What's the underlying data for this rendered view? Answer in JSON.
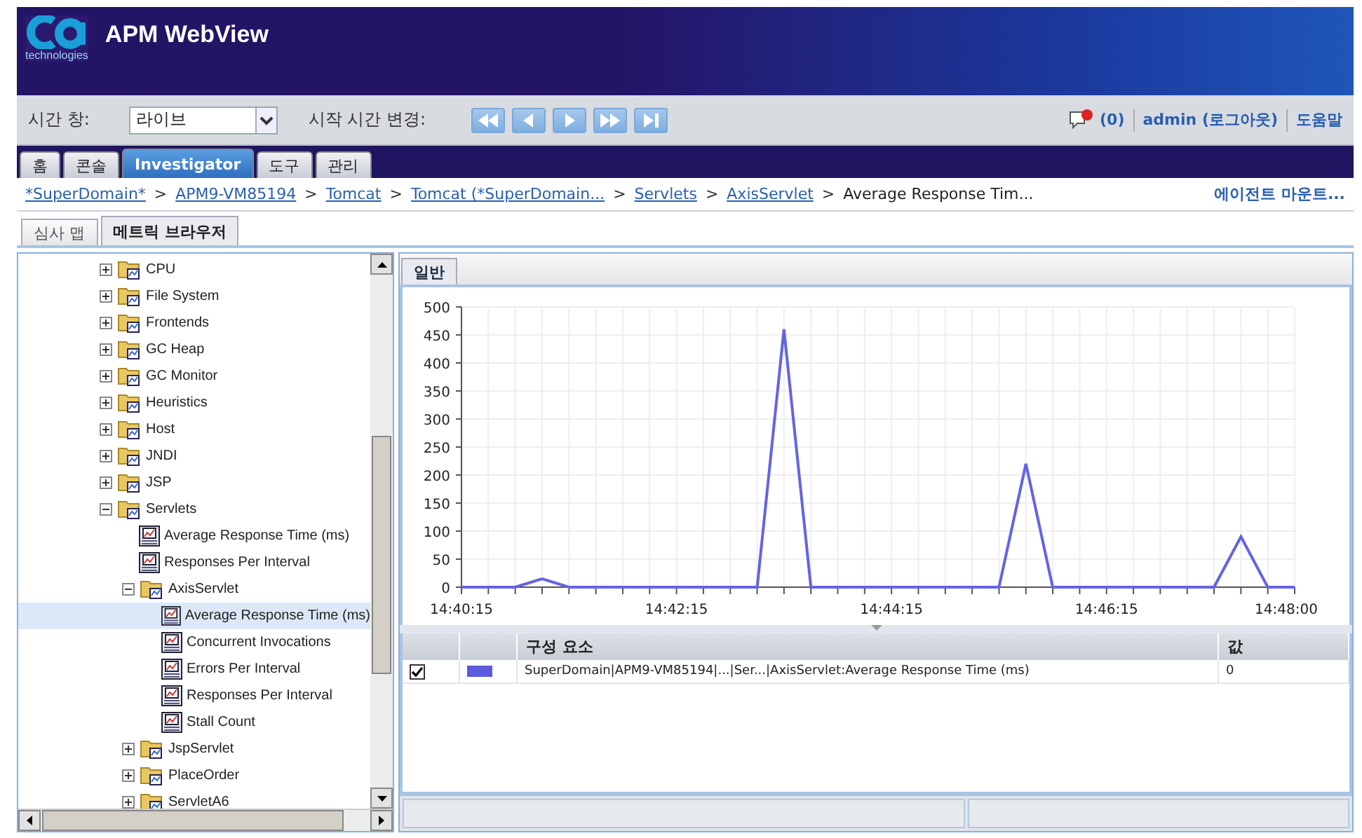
{
  "header": {
    "logo_text": "technologies",
    "title": "APM WebView"
  },
  "toolbar": {
    "time_window_label": "시간 창:",
    "time_window_value": "라이브",
    "start_time_label": "시작 시간 변경:",
    "alerts": "(0)",
    "user": "admin (로그아웃)",
    "help": "도움말"
  },
  "tabs": [
    {
      "label": "홈",
      "selected": false
    },
    {
      "label": "콘솔",
      "selected": false
    },
    {
      "label": "Investigator",
      "selected": true
    },
    {
      "label": "도구",
      "selected": false
    },
    {
      "label": "관리",
      "selected": false
    }
  ],
  "breadcrumb": {
    "items": [
      {
        "label": "*SuperDomain*",
        "kind": "link"
      },
      {
        "label": ">",
        "kind": "separator"
      },
      {
        "label": "APM9-VM85194",
        "kind": "link"
      },
      {
        "label": ">",
        "kind": "separator"
      },
      {
        "label": "Tomcat",
        "kind": "link"
      },
      {
        "label": ">",
        "kind": "separator"
      },
      {
        "label": "Tomcat (*SuperDomain...",
        "kind": "link"
      },
      {
        "label": ">",
        "kind": "separator"
      },
      {
        "label": "Servlets",
        "kind": "link"
      },
      {
        "label": ">",
        "kind": "separator"
      },
      {
        "label": "AxisServlet",
        "kind": "link"
      },
      {
        "label": ">",
        "kind": "separator"
      },
      {
        "label": "Average Response Tim...",
        "kind": "current"
      }
    ],
    "agent_mount": "에이전트 마운트..."
  },
  "sub_tabs": [
    {
      "label": "심사 맵",
      "selected": false
    },
    {
      "label": "메트릭 브라우저",
      "selected": true
    }
  ],
  "tree": [
    {
      "label": "CPU",
      "kind": "folder",
      "expanded": false,
      "selected": false
    },
    {
      "label": "File System",
      "kind": "folder",
      "expanded": false,
      "selected": false
    },
    {
      "label": "Frontends",
      "kind": "folder",
      "expanded": false,
      "selected": false
    },
    {
      "label": "GC Heap",
      "kind": "folder",
      "expanded": false,
      "selected": false
    },
    {
      "label": "GC Monitor",
      "kind": "folder",
      "expanded": false,
      "selected": false
    },
    {
      "label": "Heuristics",
      "kind": "folder",
      "expanded": false,
      "selected": false
    },
    {
      "label": "Host",
      "kind": "folder",
      "expanded": false,
      "selected": false
    },
    {
      "label": "JNDI",
      "kind": "folder",
      "expanded": false,
      "selected": false
    },
    {
      "label": "JSP",
      "kind": "folder",
      "expanded": false,
      "selected": false
    },
    {
      "label": "Servlets",
      "kind": "folder",
      "expanded": true,
      "selected": false,
      "children": [
        {
          "label": "Average Response Time (ms)",
          "kind": "metric",
          "selected": false
        },
        {
          "label": "Responses Per Interval",
          "kind": "metric",
          "selected": false
        },
        {
          "label": "AxisServlet",
          "kind": "folder",
          "expanded": true,
          "selected": false,
          "children": [
            {
              "label": "Average Response Time (ms)",
              "kind": "metric",
              "selected": true
            },
            {
              "label": "Concurrent Invocations",
              "kind": "metric",
              "selected": false
            },
            {
              "label": "Errors Per Interval",
              "kind": "metric",
              "selected": false
            },
            {
              "label": "Responses Per Interval",
              "kind": "metric",
              "selected": false
            },
            {
              "label": "Stall Count",
              "kind": "metric",
              "selected": false
            }
          ]
        },
        {
          "label": "JspServlet",
          "kind": "folder",
          "expanded": false,
          "selected": false
        },
        {
          "label": "PlaceOrder",
          "kind": "folder",
          "expanded": false,
          "selected": false
        },
        {
          "label": "ServletA6",
          "kind": "folder",
          "expanded": false,
          "selected": false
        }
      ]
    }
  ],
  "panel_tabs": [
    {
      "label": "일반",
      "selected": true
    }
  ],
  "chart_data": {
    "type": "line",
    "categories": [
      "14:40:15",
      null,
      null,
      null,
      null,
      null,
      null,
      null,
      "14:42:15",
      null,
      null,
      null,
      null,
      null,
      null,
      null,
      "14:44:15",
      null,
      null,
      null,
      null,
      null,
      null,
      null,
      "14:46:15",
      null,
      null,
      null,
      null,
      null,
      null,
      "14:48:00"
    ],
    "grid": true,
    "series": [
      {
        "color": "#6363e6",
        "values": [
          0,
          0,
          0,
          15,
          0,
          0,
          0,
          0,
          0,
          0,
          0,
          0,
          460,
          0,
          0,
          0,
          0,
          0,
          0,
          0,
          0,
          220,
          0,
          0,
          0,
          0,
          0,
          0,
          0,
          90,
          0,
          0
        ]
      }
    ],
    "ylim": [
      0,
      500
    ],
    "yticks": [
      0,
      50,
      100,
      150,
      200,
      250,
      300,
      350,
      400,
      450,
      500
    ]
  },
  "table": {
    "columns": [
      "구성 요소",
      "값"
    ],
    "rows": [
      {
        "checked": true,
        "color": "#5b5be0",
        "component": "SuperDomain|APM9-VM85194|...|Ser...|AxisServlet:Average Response Time (ms)",
        "value": "0"
      }
    ]
  }
}
